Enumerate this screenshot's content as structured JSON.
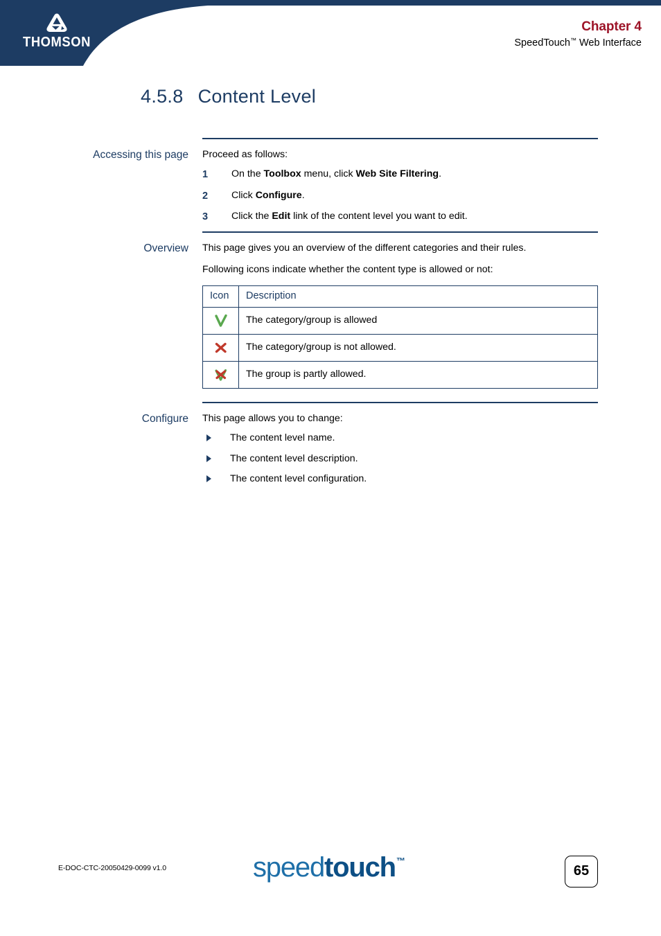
{
  "header": {
    "logo_name": "THOMSON",
    "chapter": "Chapter 4",
    "chapter_subtitle_main": "SpeedTouch",
    "chapter_subtitle_tm": "™",
    "chapter_subtitle_rest": " Web Interface",
    "navy": "#1d3c63",
    "chapter_color": "#9d1428"
  },
  "title": {
    "number": "4.5.8",
    "text": "Content Level"
  },
  "sections": {
    "accessing": {
      "label": "Accessing this page",
      "intro": "Proceed as follows:",
      "steps": [
        {
          "num": "1",
          "pre": "On the ",
          "b1": "Toolbox",
          "mid": " menu, click ",
          "b2": "Web Site Filtering",
          "post": "."
        },
        {
          "num": "2",
          "pre": "Click ",
          "b1": "Configure",
          "mid": "",
          "b2": "",
          "post": "."
        },
        {
          "num": "3",
          "pre": "Click the ",
          "b1": "Edit",
          "mid": " link of the content level you want to edit.",
          "b2": "",
          "post": ""
        }
      ]
    },
    "overview": {
      "label": "Overview",
      "para1": "This page gives you an overview of the different categories and their rules.",
      "para2": "Following icons indicate whether the content type is allowed or not:",
      "table": {
        "headers": [
          "Icon",
          "Description"
        ],
        "rows": [
          {
            "icon": "allowed-check-icon",
            "description": "The category/group is allowed"
          },
          {
            "icon": "not-allowed-cross-icon",
            "description": "The category/group is not allowed."
          },
          {
            "icon": "partly-allowed-icon",
            "description": "The group is partly allowed."
          }
        ]
      }
    },
    "configure": {
      "label": "Configure",
      "intro": "This page allows you to change:",
      "bullets": [
        "The content level name.",
        "The content level description.",
        "The content level configuration."
      ]
    }
  },
  "footer": {
    "doc_code": "E-DOC-CTC-20050429-0099 v1.0",
    "logo_speed": "speed",
    "logo_touch": "touch",
    "logo_tm": "™",
    "page_number": "65"
  }
}
